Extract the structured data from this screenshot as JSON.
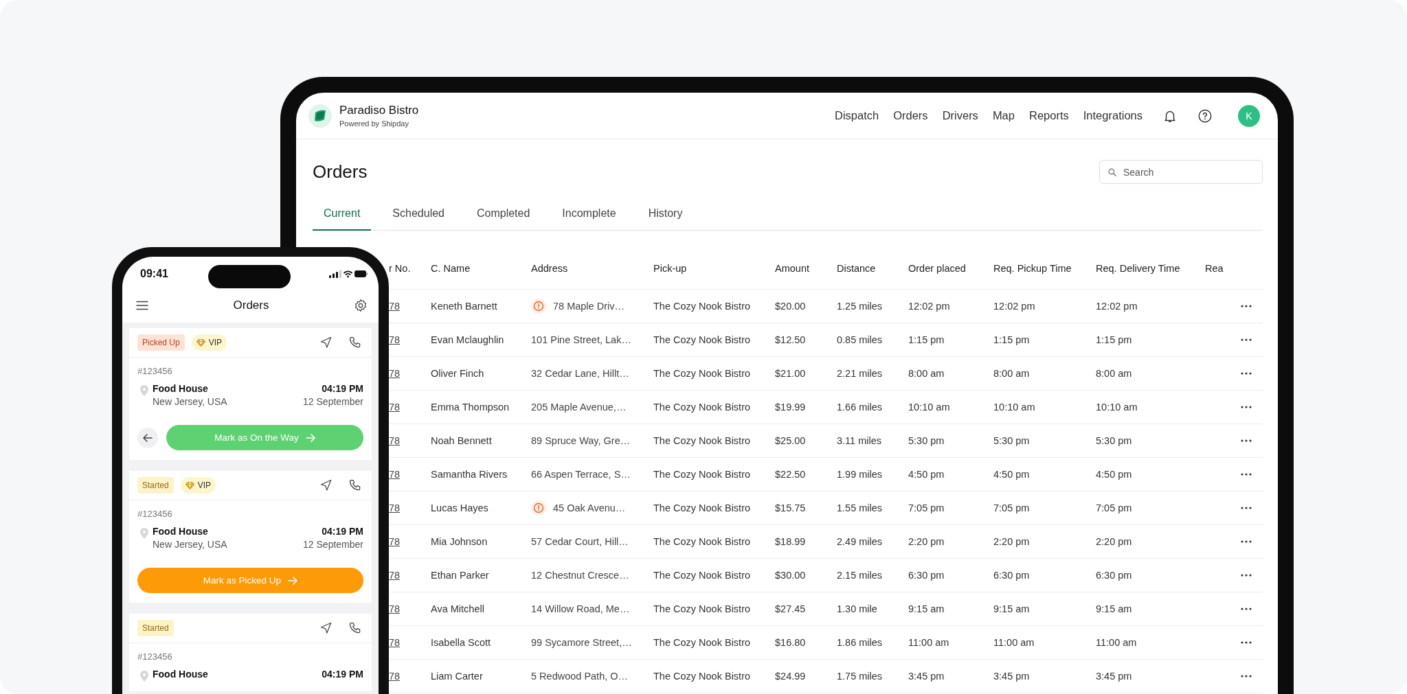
{
  "tablet": {
    "brand": {
      "name": "Paradiso Bistro",
      "tagline": "Powered by Shipday"
    },
    "nav": [
      {
        "label": "Dispatch"
      },
      {
        "label": "Orders"
      },
      {
        "label": "Drivers"
      },
      {
        "label": "Map"
      },
      {
        "label": "Reports"
      },
      {
        "label": "Integrations"
      }
    ],
    "avatar": "K",
    "title": "Orders",
    "search": {
      "placeholder": "Search"
    },
    "tabs": [
      {
        "label": "Current",
        "selected": true
      },
      {
        "label": "Scheduled",
        "selected": false
      },
      {
        "label": "Completed",
        "selected": false
      },
      {
        "label": "Incomplete",
        "selected": false
      },
      {
        "label": "History",
        "selected": false
      }
    ],
    "table": {
      "columns": [
        "r No.",
        "C. Name",
        "Address",
        "Pick-up",
        "Amount",
        "Distance",
        "Order placed",
        "Req. Pickup Time",
        "Req. Delivery Time",
        "Rea"
      ],
      "rows": [
        {
          "order": "78",
          "name": "Keneth Barnett",
          "warning": true,
          "address": "78 Maple Driv…",
          "pickup": "The Cozy Nook Bistro",
          "amount": "$20.00",
          "distance": "1.25 miles",
          "placed": "12:02 pm",
          "pickup_time": "12:02 pm",
          "delivery_time": "12:02 pm"
        },
        {
          "order": "78",
          "name": "Evan Mclaughlin",
          "warning": false,
          "address": "101 Pine Street, Lak…",
          "pickup": "The Cozy Nook Bistro",
          "amount": "$12.50",
          "distance": "0.85 miles",
          "placed": "1:15 pm",
          "pickup_time": "1:15 pm",
          "delivery_time": "1:15 pm"
        },
        {
          "order": "78",
          "name": "Oliver Finch",
          "warning": false,
          "address": "32 Cedar Lane, Hillt…",
          "pickup": "The Cozy Nook Bistro",
          "amount": "$21.00",
          "distance": "2.21 miles",
          "placed": "8:00 am",
          "pickup_time": "8:00 am",
          "delivery_time": "8:00 am"
        },
        {
          "order": "78",
          "name": "Emma Thompson",
          "warning": false,
          "address": "205 Maple Avenue,…",
          "pickup": "The Cozy Nook Bistro",
          "amount": "$19.99",
          "distance": "1.66 miles",
          "placed": "10:10 am",
          "pickup_time": "10:10 am",
          "delivery_time": "10:10 am"
        },
        {
          "order": "78",
          "name": "Noah Bennett",
          "warning": false,
          "address": "89 Spruce Way, Gre…",
          "pickup": "The Cozy Nook Bistro",
          "amount": "$25.00",
          "distance": "3.11 miles",
          "placed": "5:30 pm",
          "pickup_time": "5:30 pm",
          "delivery_time": "5:30 pm"
        },
        {
          "order": "78",
          "name": "Samantha Rivers",
          "warning": false,
          "address": "66 Aspen Terrace, S…",
          "pickup": "The Cozy Nook Bistro",
          "amount": "$22.50",
          "distance": "1.99 miles",
          "placed": "4:50 pm",
          "pickup_time": "4:50 pm",
          "delivery_time": "4:50 pm"
        },
        {
          "order": "78",
          "name": "Lucas Hayes",
          "warning": true,
          "address": "45 Oak Avenu…",
          "pickup": "The Cozy Nook Bistro",
          "amount": "$15.75",
          "distance": "1.55 miles",
          "placed": "7:05 pm",
          "pickup_time": "7:05 pm",
          "delivery_time": "7:05 pm"
        },
        {
          "order": "78",
          "name": "Mia Johnson",
          "warning": false,
          "address": "57 Cedar Court, Hill…",
          "pickup": "The Cozy Nook Bistro",
          "amount": "$18.99",
          "distance": "2.49 miles",
          "placed": "2:20 pm",
          "pickup_time": "2:20 pm",
          "delivery_time": "2:20 pm"
        },
        {
          "order": "78",
          "name": "Ethan Parker",
          "warning": false,
          "address": "12 Chestnut Cresce…",
          "pickup": "The Cozy Nook Bistro",
          "amount": "$30.00",
          "distance": "2.15 miles",
          "placed": "6:30 pm",
          "pickup_time": "6:30 pm",
          "delivery_time": "6:30 pm"
        },
        {
          "order": "78",
          "name": "Ava Mitchell",
          "warning": false,
          "address": "14 Willow Road, Me…",
          "pickup": "The Cozy Nook Bistro",
          "amount": "$27.45",
          "distance": "1.30 mile",
          "placed": "9:15 am",
          "pickup_time": "9:15 am",
          "delivery_time": "9:15 am"
        },
        {
          "order": "78",
          "name": "Isabella Scott",
          "warning": false,
          "address": "99 Sycamore Street,…",
          "pickup": "The Cozy Nook Bistro",
          "amount": "$16.80",
          "distance": "1.86 miles",
          "placed": "11:00 am",
          "pickup_time": "11:00 am",
          "delivery_time": "11:00 am"
        },
        {
          "order": "78",
          "name": "Liam Carter",
          "warning": false,
          "address": "5 Redwood Path, O…",
          "pickup": "The Cozy Nook Bistro",
          "amount": "$24.99",
          "distance": "1.75 miles",
          "placed": "3:45 pm",
          "pickup_time": "3:45 pm",
          "delivery_time": "3:45 pm"
        }
      ]
    }
  },
  "phone": {
    "time": "09:41",
    "title": "Orders",
    "cards": [
      {
        "status": {
          "label": "Picked Up",
          "kind": "picked_up"
        },
        "vip": "VIP",
        "order": "#123456",
        "place": "Food House",
        "location": "New Jersey, USA",
        "time": "04:19 PM",
        "date": "12 September",
        "back": true,
        "action": {
          "label": "Mark as On the Way",
          "kind": "green"
        }
      },
      {
        "status": {
          "label": "Started",
          "kind": "started"
        },
        "vip": "VIP",
        "order": "#123456",
        "place": "Food House",
        "location": "New Jersey, USA",
        "time": "04:19 PM",
        "date": "12 September",
        "back": false,
        "action": {
          "label": "Mark as Picked Up",
          "kind": "orange"
        }
      },
      {
        "status": {
          "label": "Started",
          "kind": "started"
        },
        "order": "#123456",
        "place": "Food House",
        "time": "04:19 PM",
        "back": false
      }
    ]
  }
}
